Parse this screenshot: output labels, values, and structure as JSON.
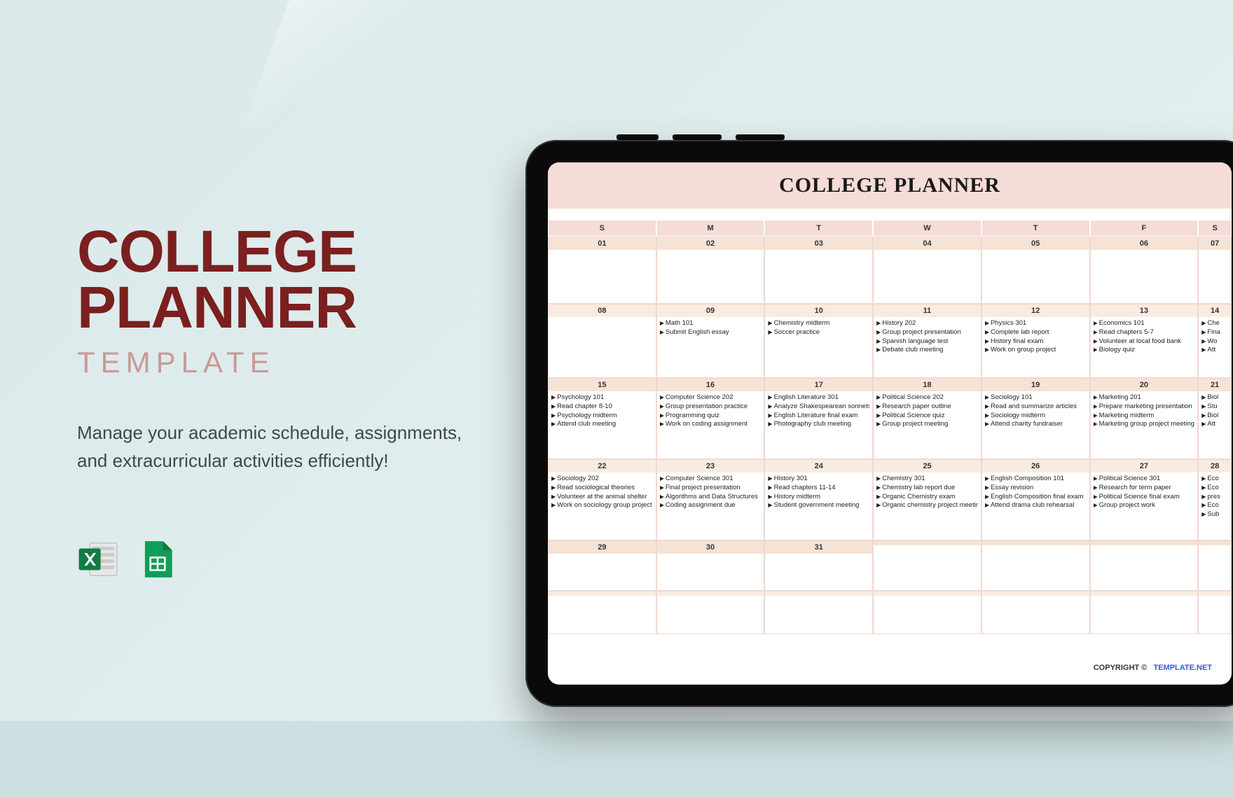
{
  "left": {
    "title_line1": "COLLEGE",
    "title_line2": "PLANNER",
    "subtitle": "TEMPLATE",
    "desc": "Manage your academic schedule, assignments, and extracurricular activities efficiently!"
  },
  "planner": {
    "title": "COLLEGE PLANNER",
    "days": [
      "S",
      "M",
      "T",
      "W",
      "T",
      "F",
      "S"
    ],
    "weeks": [
      {
        "dates": [
          "01",
          "02",
          "03",
          "04",
          "05",
          "06",
          "07"
        ],
        "tasks": [
          [],
          [],
          [],
          [],
          [],
          [],
          []
        ]
      },
      {
        "dates": [
          "08",
          "09",
          "10",
          "11",
          "12",
          "13",
          "14"
        ],
        "tasks": [
          [],
          [
            "Math 101",
            "Submit English essay"
          ],
          [
            "Chemistry midterm",
            "Soccer practice"
          ],
          [
            "History 202",
            "Group project presentation",
            "Spanish language test",
            "Debate club meeting"
          ],
          [
            "Physics 301",
            "Complete lab report",
            "History final exam",
            "Work on group project"
          ],
          [
            "Economics 101",
            "Read chapters 5-7",
            "Volunteer at local food bank",
            "Biology quiz"
          ],
          [
            "Che",
            "Fina",
            "Wo",
            "Att"
          ]
        ]
      },
      {
        "dates": [
          "15",
          "16",
          "17",
          "18",
          "19",
          "20",
          "21"
        ],
        "tasks": [
          [
            "Psychology 101",
            "Read chapter 8-10",
            "Psychology midterm",
            "Attend club meeting"
          ],
          [
            "Computer Science 202",
            "Group presentation practice",
            "Programming quiz",
            "Work on coding assignment"
          ],
          [
            "English Literature 301",
            "Analyze Shakespearean sonnets",
            "English Literature final exam",
            "Photography club meeting"
          ],
          [
            "Political Science 202",
            "Research paper outline",
            "Political Science quiz",
            "Group project meeting"
          ],
          [
            "Sociology 101",
            "Read and summarize articles",
            "Sociology midterm",
            "Attend charity fundraiser"
          ],
          [
            "Marketing 201",
            "Prepare marketing presentation",
            "Marketing midterm",
            "Marketing group project meeting"
          ],
          [
            "Biol",
            "Stu",
            "Biol",
            "Att"
          ]
        ]
      },
      {
        "dates": [
          "22",
          "23",
          "24",
          "25",
          "26",
          "27",
          "28"
        ],
        "tasks": [
          [
            "Sociology 202",
            "Read sociological theories",
            "Volunteer at the animal shelter",
            "Work on sociology group project"
          ],
          [
            "Computer Science 301",
            "Final project presentation",
            "Algorithms and Data Structures",
            "Coding assignment due"
          ],
          [
            "History 301",
            "Read chapters 11-14",
            "History midterm",
            "Student government meeting"
          ],
          [
            "Chemistry 301",
            "Chemistry lab report due",
            "Organic Chemistry exam",
            "Organic chemistry project meeting"
          ],
          [
            "English Composition 101",
            "Essay revision",
            "English Composition final exam",
            "Attend drama club rehearsal"
          ],
          [
            "Political Science 301",
            "Research for term paper",
            "Political Science final exam",
            "Group project work"
          ],
          [
            "Eco",
            "Eco",
            "pres",
            "Eco",
            "Sub"
          ]
        ]
      },
      {
        "dates": [
          "29",
          "30",
          "31",
          "",
          "",
          "",
          ""
        ],
        "tasks": [
          [],
          [],
          [],
          [],
          [],
          [],
          []
        ]
      },
      {
        "dates": [
          "",
          "",
          "",
          "",
          "",
          "",
          ""
        ],
        "tasks": [
          [],
          [],
          [],
          [],
          [],
          [],
          []
        ]
      }
    ],
    "copyright_label": "COPYRIGHT  ©",
    "copyright_link": "TEMPLATE.NET"
  }
}
